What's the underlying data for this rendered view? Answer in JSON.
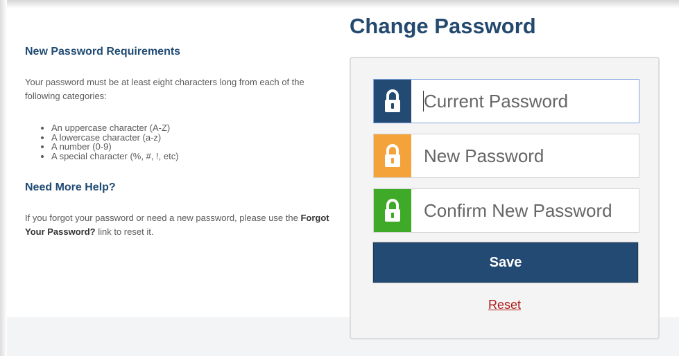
{
  "left": {
    "requirements_title": "New Password Requirements",
    "requirements_text": "Your password must be at least eight characters long from each of the following categories:",
    "requirements_list": [
      "An uppercase character (A-Z)",
      "A lowercase character (a-z)",
      "A number (0-9)",
      "A special character (%, #, !, etc)"
    ],
    "help_title": "Need More Help?",
    "help_text_before": "If you forgot your password or need a new password, please use the ",
    "help_link_text": "Forgot Your Password?",
    "help_text_after": " link to reset it."
  },
  "form": {
    "title": "Change Password",
    "fields": [
      {
        "placeholder": "Current Password",
        "value": "",
        "icon": "lock-icon",
        "color": "#234a72"
      },
      {
        "placeholder": "New Password",
        "value": "",
        "icon": "lock-icon",
        "color": "#f4a23a"
      },
      {
        "placeholder": "Confirm New Password",
        "value": "",
        "icon": "lock-icon",
        "color": "#3faa27"
      }
    ],
    "save_label": "Save",
    "reset_label": "Reset"
  },
  "colors": {
    "accent": "#234a72",
    "link": "#b01c1c"
  }
}
